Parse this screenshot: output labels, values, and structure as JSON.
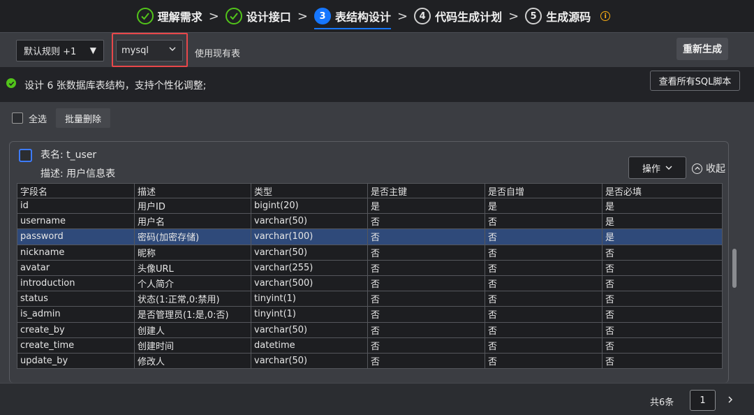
{
  "stepper": {
    "steps": [
      {
        "number": "1",
        "label": "理解需求",
        "state": "done"
      },
      {
        "number": "2",
        "label": "设计接口",
        "state": "done"
      },
      {
        "number": "3",
        "label": "表结构设计",
        "state": "active"
      },
      {
        "number": "4",
        "label": "代码生成计划",
        "state": "todo"
      },
      {
        "number": "5",
        "label": "生成源码",
        "state": "todo"
      }
    ],
    "warning_icon": "info-circle-icon",
    "colors": {
      "done": "#52c41a",
      "active": "#1677ff",
      "warning": "#faad14"
    }
  },
  "toolbar": {
    "rule_select_value": "默认规则 +1",
    "db_select_value": "mysql",
    "use_existing_label": "使用现有表",
    "regenerate_label": "重新生成",
    "highlight_color": "#e8474a"
  },
  "info": {
    "message": "设计 6 张数据库表结构，支持个性化调整;",
    "view_sql_label": "查看所有SQL脚本"
  },
  "bulk": {
    "select_all_label": "全选",
    "batch_delete_label": "批量删除"
  },
  "table_card": {
    "name_label": "表名: t_user",
    "desc_label": "描述: 用户信息表",
    "ops_label": "操作",
    "collapse_label": "收起",
    "columns": [
      "字段名",
      "描述",
      "类型",
      "是否主键",
      "是否自增",
      "是否必填"
    ],
    "rows": [
      [
        "id",
        "用户ID",
        "bigint(20)",
        "是",
        "是",
        "是"
      ],
      [
        "username",
        "用户名",
        "varchar(50)",
        "否",
        "否",
        "是"
      ],
      [
        "password",
        "密码(加密存储)",
        "varchar(100)",
        "否",
        "否",
        "是"
      ],
      [
        "nickname",
        "昵称",
        "varchar(50)",
        "否",
        "否",
        "否"
      ],
      [
        "avatar",
        "头像URL",
        "varchar(255)",
        "否",
        "否",
        "否"
      ],
      [
        "introduction",
        "个人简介",
        "varchar(500)",
        "否",
        "否",
        "否"
      ],
      [
        "status",
        "状态(1:正常,0:禁用)",
        "tinyint(1)",
        "否",
        "否",
        "否"
      ],
      [
        "is_admin",
        "是否管理员(1:是,0:否)",
        "tinyint(1)",
        "否",
        "否",
        "否"
      ],
      [
        "create_by",
        "创建人",
        "varchar(50)",
        "否",
        "否",
        "否"
      ],
      [
        "create_time",
        "创建时间",
        "datetime",
        "否",
        "否",
        "否"
      ],
      [
        "update_by",
        "修改人",
        "varchar(50)",
        "否",
        "否",
        "否"
      ]
    ],
    "selected_row_index": 2,
    "selected_row_color": "#2f4a7a"
  },
  "pagination": {
    "total_label": "共6条",
    "current_page": "1"
  }
}
